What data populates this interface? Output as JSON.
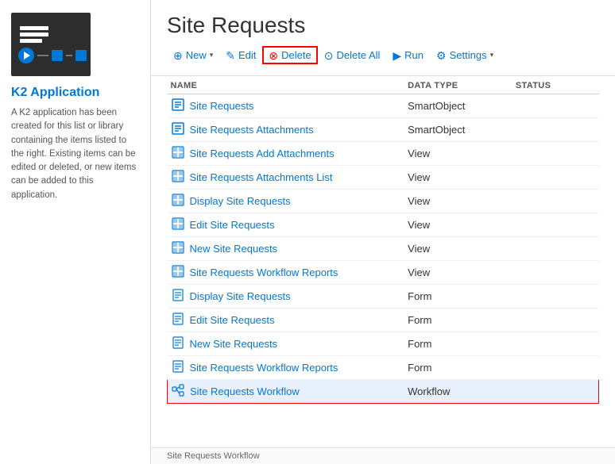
{
  "sidebar": {
    "logo_alt": "K2 Application Logo",
    "app_name": "K2 Application",
    "description": "A K2 application has been created for this list or library containing the items listed to the right. Existing items can be edited or deleted, or new items can be added to this application."
  },
  "header": {
    "title": "Site Requests"
  },
  "toolbar": {
    "new_label": "New",
    "edit_label": "Edit",
    "delete_label": "Delete",
    "delete_all_label": "Delete All",
    "run_label": "Run",
    "settings_label": "Settings"
  },
  "table": {
    "columns": [
      "NAME",
      "DATA TYPE",
      "STATUS"
    ],
    "rows": [
      {
        "name": "Site Requests",
        "type": "SmartObject",
        "status": "",
        "icon": "smartobject",
        "selected": false
      },
      {
        "name": "Site Requests Attachments",
        "type": "SmartObject",
        "status": "",
        "icon": "smartobject",
        "selected": false
      },
      {
        "name": "Site Requests Add Attachments",
        "type": "View",
        "status": "",
        "icon": "view",
        "selected": false
      },
      {
        "name": "Site Requests Attachments List",
        "type": "View",
        "status": "",
        "icon": "view",
        "selected": false
      },
      {
        "name": "Display Site Requests",
        "type": "View",
        "status": "",
        "icon": "view",
        "selected": false
      },
      {
        "name": "Edit Site Requests",
        "type": "View",
        "status": "",
        "icon": "view",
        "selected": false
      },
      {
        "name": "New Site Requests",
        "type": "View",
        "status": "",
        "icon": "view",
        "selected": false
      },
      {
        "name": "Site Requests Workflow Reports",
        "type": "View",
        "status": "",
        "icon": "view",
        "selected": false
      },
      {
        "name": "Display Site Requests",
        "type": "Form",
        "status": "",
        "icon": "form",
        "selected": false
      },
      {
        "name": "Edit Site Requests",
        "type": "Form",
        "status": "",
        "icon": "form",
        "selected": false
      },
      {
        "name": "New Site Requests",
        "type": "Form",
        "status": "",
        "icon": "form",
        "selected": false
      },
      {
        "name": "Site Requests Workflow Reports",
        "type": "Form",
        "status": "",
        "icon": "form",
        "selected": false
      },
      {
        "name": "Site Requests Workflow",
        "type": "Workflow",
        "status": "",
        "icon": "workflow",
        "selected": true
      }
    ]
  },
  "footer": {
    "text": "Site Requests Workflow"
  },
  "icons": {
    "smartobject": "🗃",
    "view": "▦",
    "form": "📄",
    "workflow": "⚡"
  }
}
